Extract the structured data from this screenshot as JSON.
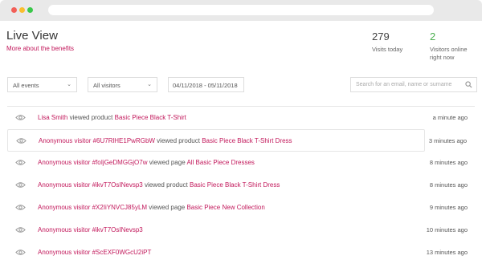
{
  "header": {
    "title": "Live View",
    "benefits_link": "More about the benefits",
    "visits_count": "279",
    "visits_label": "Visits today",
    "online_count": "2",
    "online_label": "Visitors online right now"
  },
  "filters": {
    "events_value": "All events",
    "visitors_value": "All visitors",
    "date_range": "04/11/2018 - 05/11/2018",
    "search_placeholder": "Search for an email, name or surname"
  },
  "feed": [
    {
      "visitor": "Lisa Smith",
      "action": "viewed product",
      "target": "Basic Piece Black T-Shirt",
      "time": "a minute ago"
    },
    {
      "visitor": "Anonymous visitor #6U7RlHE1PwRGbW",
      "action": "viewed product",
      "target": "Basic Piece Black T-Shirt Dress",
      "time": "3 minutes ago"
    },
    {
      "visitor": "Anonymous visitor #foIjGeDMGGjO7w",
      "action": "viewed page",
      "target": "All Basic Piece Dresses",
      "time": "8 minutes ago"
    },
    {
      "visitor": "Anonymous visitor #ikvT7OsINevsp3",
      "action": "viewed product",
      "target": "Basic Piece Black T-Shirt Dress",
      "time": "8 minutes ago"
    },
    {
      "visitor": "Anonymous visitor #X2IiYNVCJ85yLM",
      "action": "viewed page",
      "target": "Basic Piece New Collection",
      "time": "9 minutes ago"
    },
    {
      "visitor": "Anonymous visitor #ikvT7OsINevsp3",
      "action": "",
      "target": "",
      "time": "10 minutes ago"
    },
    {
      "visitor": "Anonymous visitor #ScEXF0WGcU2iPT",
      "action": "",
      "target": "",
      "time": "13 minutes ago"
    }
  ]
}
